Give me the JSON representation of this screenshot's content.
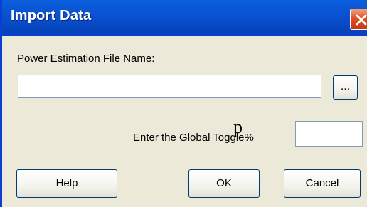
{
  "window": {
    "title": "Import Data"
  },
  "form": {
    "file_name_label": "Power Estimation File Name:",
    "file_name_value": "",
    "browse_label": "...",
    "toggle_label": "Enter the Global Toggle%",
    "toggle_overlay_glyph": "p",
    "toggle_value": ""
  },
  "buttons": {
    "help": "Help",
    "ok": "OK",
    "cancel": "Cancel"
  },
  "colors": {
    "titlebar": "#0951d1",
    "dialog_background": "#ece9d8",
    "close_button": "#e05020"
  },
  "icons": {
    "close": "close-icon"
  }
}
